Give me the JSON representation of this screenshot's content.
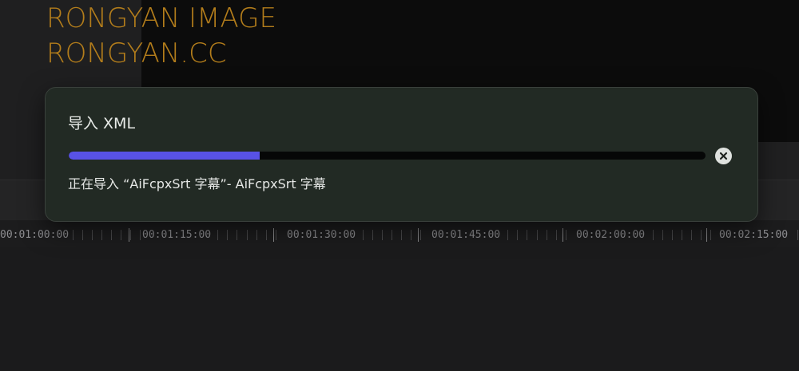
{
  "watermark": {
    "line1": "RONGYAN IMAGE",
    "line2": "RONGYAN.CC",
    "color": "#b37d1b"
  },
  "dialog": {
    "title": "导入 XML",
    "progress_fraction": 0.3,
    "progress_color": "#5852e6",
    "status": "正在导入 “AiFcpxSrt 字幕”- AiFcpxSrt 字幕",
    "cancel_icon": "close-circle-icon"
  },
  "timeline": {
    "ruler_labels": [
      "00:01:00:00",
      "00:01:15:00",
      "00:01:30:00",
      "00:01:45:00",
      "00:02:00:00",
      "00:02:15:00"
    ]
  }
}
